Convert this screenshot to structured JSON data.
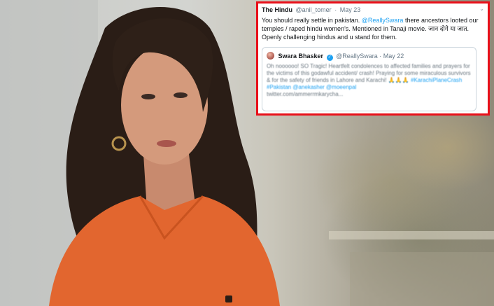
{
  "tweet": {
    "author": "The Hindu",
    "handle": "@anil_tomer",
    "separator": "·",
    "date": "May 23",
    "text_before": "You should really settle in pakistan.",
    "mention": "@ReallySwara",
    "text_after": "there ancestors looted our temples / raped hindu women's. Mentioned in Tanaji movie.  जान दोगे या जात. Openly challenging hindus and u stand for them.",
    "quoted": {
      "name": "Swara Bhasker",
      "handle": "@ReallySwara",
      "separator": "·",
      "date": "May 22",
      "text": "Oh noooooo! SO Tragic! Heartfelt condolences to affected families and prayers for the victims of this godawful accident/ crash! Praying for some miraculous survivors & for the safety of friends in Lahore and Karachi! 🙏🙏🙏",
      "hashtags": "#KarachiPlaneCrash #Pakistan @anekasher @moeenpal",
      "link": "twitter.com/ammerrmkarycha..."
    }
  },
  "colors": {
    "frame": "#e8101a",
    "link": "#1da1f2",
    "top": "#e2662f",
    "hair": "#2a1d16"
  },
  "icons": [
    "chevron-down-icon",
    "verified-icon",
    "avatar"
  ]
}
